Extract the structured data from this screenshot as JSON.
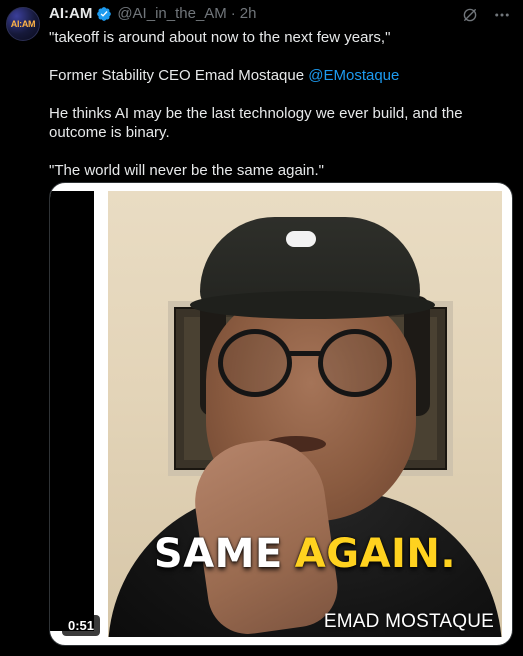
{
  "author": {
    "avatar_text": "AI:AM",
    "display_name": "AI:AM",
    "handle": "@AI_in_the_AM",
    "separator": "·",
    "time": "2h"
  },
  "tweet": {
    "line1": "\"takeoff is around about now to the next few years,\"",
    "line2_prefix": "Former Stability CEO Emad Mostaque ",
    "line2_mention": "@EMostaque",
    "line3": "He thinks AI may be the last technology we ever build, and the outcome is binary.",
    "line4": "\"The world will never be the same again.\""
  },
  "media": {
    "caption_word1": "SAME",
    "caption_word2": "AGAIN.",
    "watermark": "EMAD MOSTAQUE",
    "duration": "0:51"
  },
  "colors": {
    "accent": "#1d9bf0",
    "caption_highlight": "#ffd21f"
  },
  "icons": {
    "verified": "verified-badge-icon",
    "grok": "grok-icon",
    "more": "more-icon"
  }
}
